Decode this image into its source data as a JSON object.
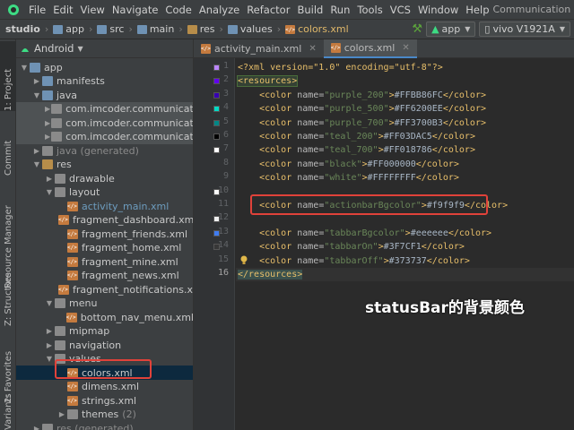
{
  "menubar": {
    "items": [
      "File",
      "Edit",
      "View",
      "Navigate",
      "Code",
      "Analyze",
      "Refactor",
      "Build",
      "Run",
      "Tools",
      "VCS",
      "Window",
      "Help"
    ],
    "window_title": "CommunicationApp - colors.xml"
  },
  "breadcrumb": [
    "studio",
    "app",
    "src",
    "main",
    "res",
    "values",
    "colors.xml"
  ],
  "toolbar": {
    "run_config": "app",
    "device": "vivo V1921A"
  },
  "tool_stripe": {
    "tabs": [
      "1: Project",
      "Commit",
      "Resource Manager",
      "Z: Structure",
      "2: Favorites",
      "Variants"
    ]
  },
  "project_panel": {
    "view_mode": "Android",
    "tree": [
      {
        "label": "app",
        "count": ""
      },
      {
        "label": "manifests",
        "count": ""
      },
      {
        "label": "java",
        "count": ""
      },
      {
        "label": "com.imcoder.communicationap",
        "count": ""
      },
      {
        "label": "com.imcoder.communicationap",
        "count": ""
      },
      {
        "label": "com.imcoder.communicationap",
        "count": ""
      },
      {
        "label": "java (generated)",
        "count": ""
      },
      {
        "label": "res",
        "count": ""
      },
      {
        "label": "drawable",
        "count": ""
      },
      {
        "label": "layout",
        "count": ""
      },
      {
        "label": "activity_main.xml",
        "count": ""
      },
      {
        "label": "fragment_dashboard.xml",
        "count": ""
      },
      {
        "label": "fragment_friends.xml",
        "count": ""
      },
      {
        "label": "fragment_home.xml",
        "count": ""
      },
      {
        "label": "fragment_mine.xml",
        "count": ""
      },
      {
        "label": "fragment_news.xml",
        "count": ""
      },
      {
        "label": "fragment_notifications.xml",
        "count": ""
      },
      {
        "label": "menu",
        "count": ""
      },
      {
        "label": "bottom_nav_menu.xml",
        "count": ""
      },
      {
        "label": "mipmap",
        "count": ""
      },
      {
        "label": "navigation",
        "count": ""
      },
      {
        "label": "values",
        "count": ""
      },
      {
        "label": "colors.xml",
        "count": ""
      },
      {
        "label": "dimens.xml",
        "count": ""
      },
      {
        "label": "strings.xml",
        "count": ""
      },
      {
        "label": "themes",
        "count": "(2)"
      },
      {
        "label": "res (generated)",
        "count": ""
      }
    ]
  },
  "editor": {
    "tabs": [
      "activity_main.xml",
      "colors.xml"
    ],
    "active_tab": "colors.xml",
    "line_numbers": [
      "1",
      "2",
      "3",
      "4",
      "5",
      "6",
      "7",
      "8",
      "9",
      "10",
      "11",
      "12",
      "13",
      "14",
      "15",
      "16"
    ],
    "swatch_colors": [
      "#BB86FC",
      "#6200EE",
      "#3700B3",
      "#03DAC5",
      "#018786",
      "#000000",
      "#FFFFFF",
      "",
      "",
      "#F9F9F9",
      "",
      "#EEEEEE",
      "#3F7CF1",
      "#373737",
      "",
      ""
    ],
    "lines": [
      {
        "t": "<?xml version=\"1.0\" encoding=\"utf-8\"?>"
      },
      {
        "t": "<resources>"
      },
      {
        "name": "purple_200",
        "value": "#FFBB86FC"
      },
      {
        "name": "purple_500",
        "value": "#FF6200EE"
      },
      {
        "name": "purple_700",
        "value": "#FF3700B3"
      },
      {
        "name": "teal_200",
        "value": "#FF03DAC5"
      },
      {
        "name": "teal_700",
        "value": "#FF018786"
      },
      {
        "name": "black",
        "value": "#FF000000"
      },
      {
        "name": "white",
        "value": "#FFFFFFFF"
      },
      {
        "t": ""
      },
      {
        "name": "actionbarBgcolor",
        "value": "#f9f9f9"
      },
      {
        "t": ""
      },
      {
        "name": "tabbarBgcolor",
        "value": "#eeeeee"
      },
      {
        "name": "tabbarOn",
        "value": "#3F7CF1"
      },
      {
        "name": "tabbarOff",
        "value": "#373737"
      },
      {
        "t": "</resources>"
      }
    ]
  },
  "annotation": "statusBar的背景颜色"
}
